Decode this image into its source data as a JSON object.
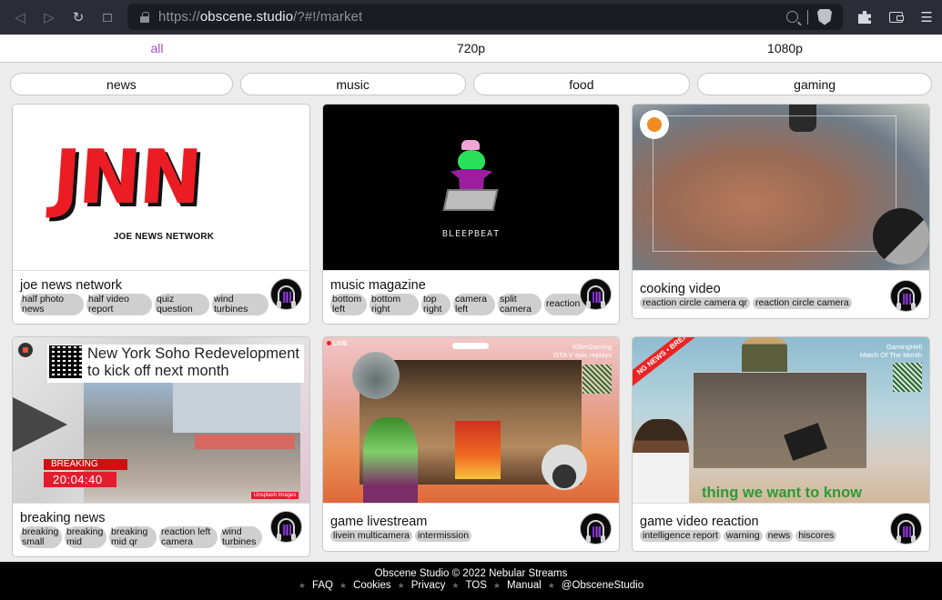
{
  "browser": {
    "url_prefix": "https://",
    "url_domain": "obscene.studio",
    "url_path": "/?#!/market",
    "icons": [
      "back-icon",
      "forward-icon",
      "reload-icon",
      "bookmark-icon",
      "lock-icon",
      "zoom-icon",
      "brave-shields-icon",
      "extensions-icon",
      "wallet-icon",
      "menu-icon"
    ]
  },
  "resolution_tabs": [
    {
      "label": "all",
      "active": true
    },
    {
      "label": "720p",
      "active": false
    },
    {
      "label": "1080p",
      "active": false
    }
  ],
  "accent_color": "#a24fc8",
  "categories": [
    "news",
    "music",
    "food",
    "gaming"
  ],
  "cards": [
    {
      "title": "joe news network",
      "tags": [
        "half photo news",
        "half video report",
        "quiz question",
        "wind turbines"
      ],
      "thumb": {
        "logo": "JNN",
        "subtitle": "JOE NEWS NETWORK"
      }
    },
    {
      "title": "music magazine",
      "tags": [
        "bottom left",
        "bottom right",
        "top right",
        "camera left",
        "split camera",
        "reaction"
      ],
      "thumb": {
        "label": "BLEEPBEAT"
      }
    },
    {
      "title": "cooking video",
      "tags": [
        "reaction circle camera qr",
        "reaction circle camera"
      ],
      "thumb": {}
    },
    {
      "title": "breaking news",
      "tags": [
        "breaking small",
        "breaking mid",
        "breaking mid qr",
        "reaction left camera",
        "wind turbines"
      ],
      "thumb": {
        "headline_1": "New York Soho Redevelopment",
        "headline_2": "to kick off next month",
        "breaking": "BREAKING NEWS",
        "clock": "20:04:40",
        "credit": "Unsplash Images"
      }
    },
    {
      "title": "game livestream",
      "tags": [
        "livein multicamera",
        "intermission"
      ],
      "thumb": {
        "live": "LIVE",
        "channel": "KillerGaming",
        "subtitle": "GTA V epic replays"
      }
    },
    {
      "title": "game video reaction",
      "tags": [
        "intelligence report",
        "warning",
        "news",
        "hiscores"
      ],
      "thumb": {
        "channel": "GamingHell",
        "subtitle": "Match Of The Month",
        "ribbon": "NG NEWS • BREA",
        "ticker": "thing we want to know"
      }
    }
  ],
  "footer": {
    "copyright": "Obscene Studio © 2022 Nebular Streams",
    "links": [
      "FAQ",
      "Cookies",
      "Privacy",
      "TOS",
      "Manual",
      "@ObsceneStudio"
    ]
  }
}
